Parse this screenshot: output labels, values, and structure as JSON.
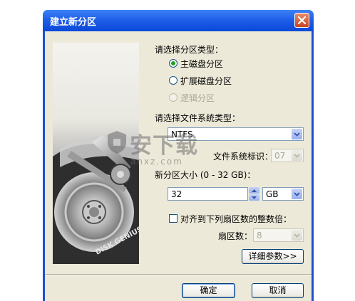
{
  "window": {
    "title": "建立新分区"
  },
  "partition_type": {
    "label": "请选择分区类型：",
    "options": [
      {
        "label": "主磁盘分区",
        "checked": true,
        "enabled": true
      },
      {
        "label": "扩展磁盘分区",
        "checked": false,
        "enabled": true
      },
      {
        "label": "逻辑分区",
        "checked": false,
        "enabled": false
      }
    ]
  },
  "filesystem": {
    "label": "请选择文件系统类型：",
    "selected": "NTFS",
    "id_label": "文件系统标识：",
    "id_value": "07"
  },
  "size": {
    "label": "新分区大小 (0 - 32 GB)：",
    "value": "32",
    "unit": "GB"
  },
  "align": {
    "label": "对齐到下列扇区数的整数倍：",
    "checked": false,
    "sectors_label": "扇区数：",
    "sectors_value": "8"
  },
  "buttons": {
    "details": "详细参数>>",
    "ok": "确定",
    "cancel": "取消"
  },
  "art": {
    "logo_text": "DISK GENIUS"
  },
  "watermark": {
    "text": "安下载",
    "sub": "anxz.com"
  }
}
